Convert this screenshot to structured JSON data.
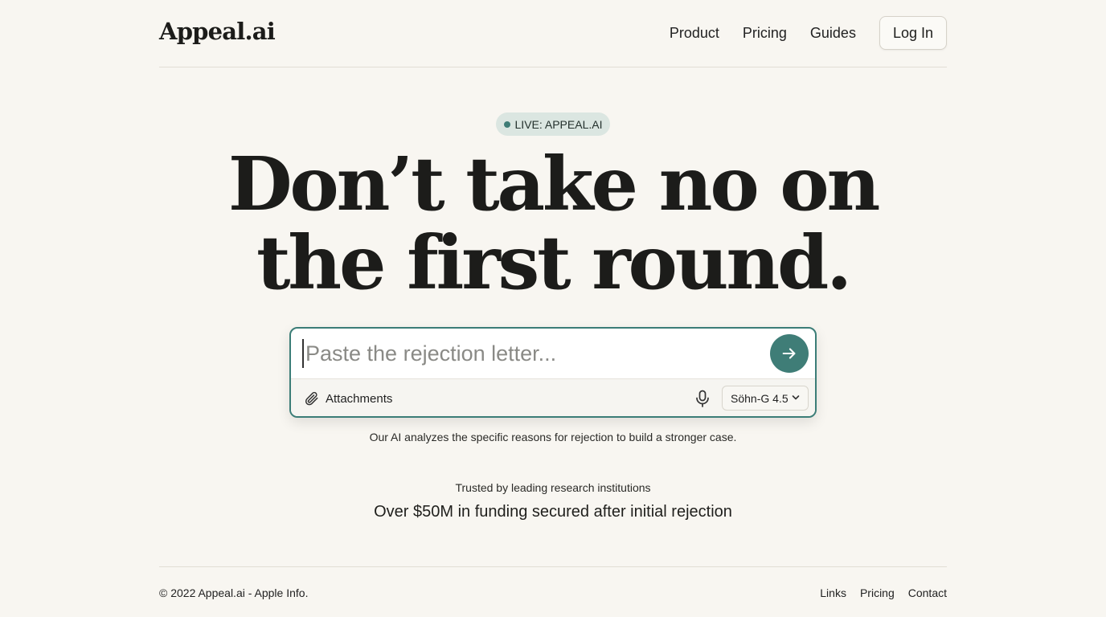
{
  "header": {
    "logo": "Appeal.ai",
    "nav": [
      "Product",
      "Pricing",
      "Guides"
    ],
    "login": "Log In"
  },
  "badge": "LIVE: APPEAL.AI",
  "headline": {
    "line1": "Don’t take no on",
    "line2": "the first round."
  },
  "composer": {
    "placeholder": "Paste the rejection letter...",
    "attachments_label": "Attachments",
    "model": "Söhn-G 4.5"
  },
  "subtext": "Our AI analyzes the specific reasons for rejection to build a stronger case.",
  "trusted": "Trusted by leading research institutions",
  "funding": "Over $50M in funding secured after initial rejection",
  "footer": {
    "copyright": "© 2022 Appeal.ai - Apple Info.",
    "links": [
      "Links",
      "Pricing",
      "Contact"
    ]
  },
  "colors": {
    "background": "#f8f6f1",
    "accent": "#3f7d77",
    "badge_bg": "#dbe6e1"
  },
  "icons": [
    "send-arrow-icon",
    "paperclip-icon",
    "microphone-icon",
    "chevron-down-icon",
    "status-dot-icon"
  ]
}
